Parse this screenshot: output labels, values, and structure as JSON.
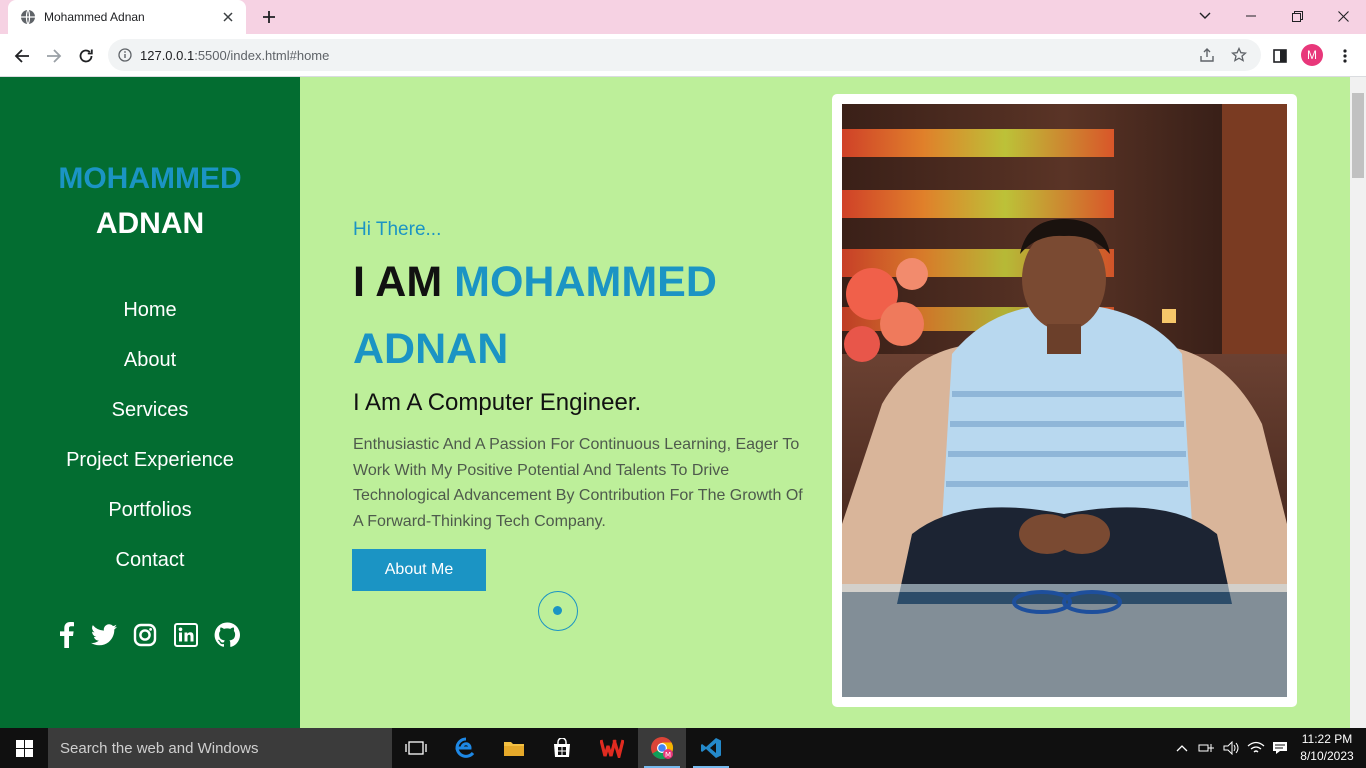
{
  "browser": {
    "tab_title": "Mohammed Adnan",
    "url_host": "127.0.0.1",
    "url_rest": ":5500/index.html#home",
    "profile_initial": "M"
  },
  "sidebar": {
    "first_name": "MOHAMMED",
    "last_name": "ADNAN",
    "nav": [
      {
        "label": "Home"
      },
      {
        "label": "About"
      },
      {
        "label": "Services"
      },
      {
        "label": "Project Experience"
      },
      {
        "label": "Portfolios"
      },
      {
        "label": "Contact"
      }
    ],
    "socials": [
      "facebook-icon",
      "twitter-icon",
      "instagram-icon",
      "linkedin-icon",
      "github-icon"
    ]
  },
  "hero": {
    "greeting": "Hi There...",
    "iam": "I AM",
    "name_line1": "MOHAMMED",
    "name_line2": "ADNAN",
    "subtitle": "I Am A Computer Engineer.",
    "description": "Enthusiastic And A Passion For Continuous Learning, Eager To Work With My Positive Potential And Talents To Drive Technological Advancement By Contribution For The Growth Of A Forward-Thinking Tech Company.",
    "button": "About Me"
  },
  "colors": {
    "accent": "#1b94c4",
    "sidebar_bg": "#036d31",
    "page_bg": "#bdef9a"
  },
  "taskbar": {
    "search_placeholder": "Search the web and Windows",
    "time": "11:22 PM",
    "date": "8/10/2023"
  }
}
